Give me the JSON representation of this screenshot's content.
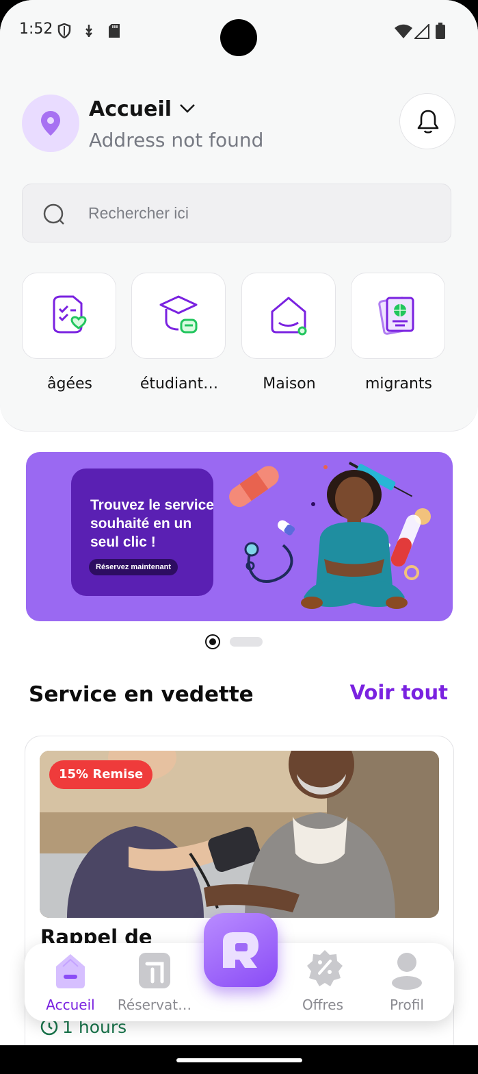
{
  "status_bar": {
    "time": "1:52",
    "icons": [
      "shield-icon",
      "usb-icon",
      "sd-card-icon",
      "wifi-icon",
      "signal-icon",
      "battery-icon"
    ]
  },
  "header": {
    "location_title": "Accueil",
    "location_subtitle": "Address not found",
    "icons": [
      "location-pin-icon",
      "chevron-down-icon",
      "bell-icon"
    ]
  },
  "search": {
    "placeholder": "Rechercher ici",
    "value": ""
  },
  "categories": [
    {
      "label": "âgées",
      "icon": "elderly-care-icon"
    },
    {
      "label": "étudiant…",
      "icon": "graduation-cap-icon"
    },
    {
      "label": "Maison",
      "icon": "home-icon"
    },
    {
      "label": "migrants",
      "icon": "passport-icon"
    }
  ],
  "banner": {
    "headline": "Trouvez le service souhaité en un seul clic !",
    "button_label": "Réservez maintenant",
    "active_slide": 1,
    "slides": 2
  },
  "featured": {
    "title": "Service en vedette",
    "see_all": "Voir tout",
    "card": {
      "discount": "15% Remise",
      "name": "Rappel de",
      "duration": "1 hours"
    }
  },
  "bottom_nav": {
    "items": [
      {
        "label": "Accueil",
        "icon": "home-icon",
        "active": true
      },
      {
        "label": "Réservat…",
        "icon": "booking-icon",
        "active": false
      },
      {
        "label": "",
        "icon": "app-logo-icon",
        "active": false
      },
      {
        "label": "Offres",
        "icon": "offers-badge-icon",
        "active": false
      },
      {
        "label": "Profil",
        "icon": "user-icon",
        "active": false
      }
    ]
  },
  "colors": {
    "accent": "#7a22e0",
    "banner": "#9a69f2",
    "discount": "#ef3b3b",
    "duration": "#17734a"
  }
}
